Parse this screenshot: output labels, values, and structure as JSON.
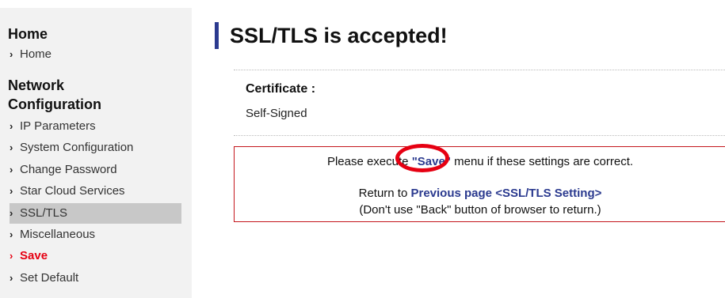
{
  "sidebar": {
    "sections": [
      {
        "heading": "Home",
        "items": [
          "Home"
        ]
      },
      {
        "heading_line1": "Network",
        "heading_line2": "Configuration",
        "items": [
          "IP Parameters",
          "System Configuration",
          "Change Password",
          "Star Cloud Services",
          "SSL/TLS",
          "Miscellaneous",
          "Save",
          "Set Default"
        ]
      }
    ],
    "active_item": "SSL/TLS",
    "save_color": "#e60012"
  },
  "main": {
    "title": "SSL/TLS is accepted!",
    "certificate_label": "Certificate :",
    "certificate_value": "Self-Signed",
    "message": {
      "pre": "Please execute ",
      "save_link": "\"Save\"",
      "post": " menu if these settings are correct.",
      "return_pre": "Return to ",
      "previous_link": "Previous page <SSL/TLS Setting>",
      "note": "(Don't use \"Back\" button of browser to return.)"
    }
  },
  "colors": {
    "accent": "#2b3a8f",
    "alert_border": "#c4161c",
    "highlight": "#e60012"
  }
}
